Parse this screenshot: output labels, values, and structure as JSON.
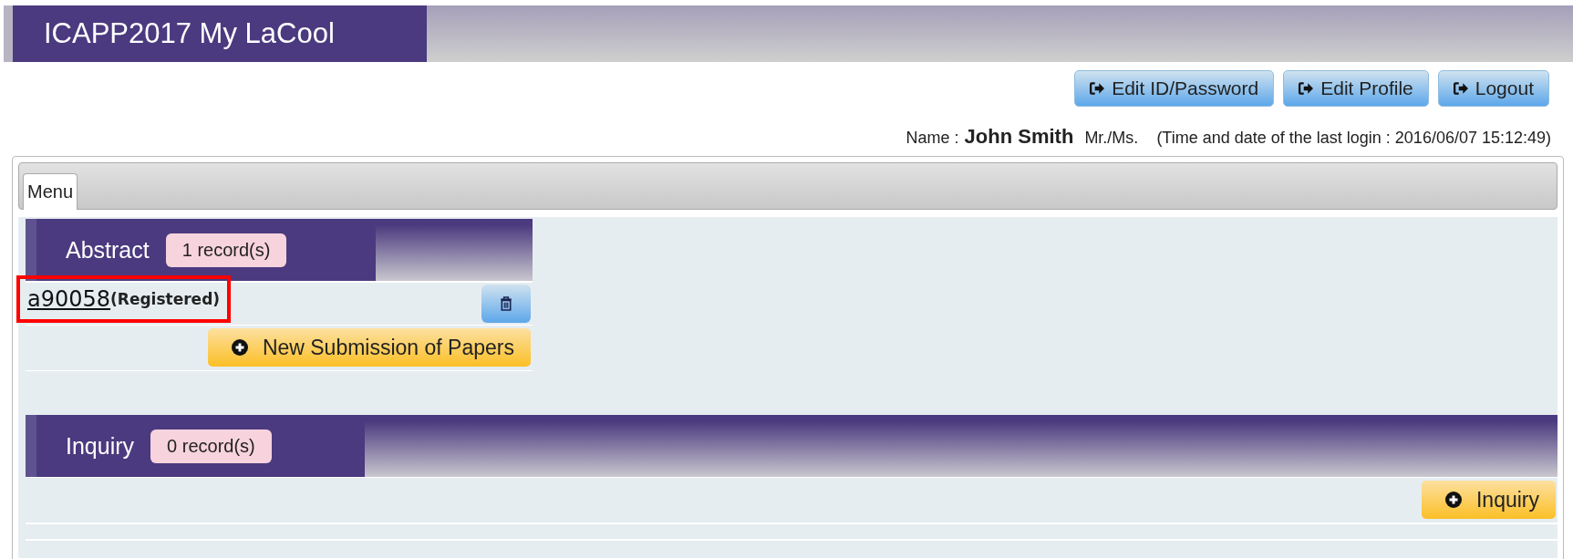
{
  "header": {
    "title": "ICAPP2017 My LaCool"
  },
  "account_buttons": [
    {
      "label": "Edit ID/Password"
    },
    {
      "label": "Edit Profile"
    },
    {
      "label": "Logout"
    }
  ],
  "user_line": {
    "name_label": "Name :",
    "name": "John Smith",
    "honorific": "Mr./Ms.",
    "last_login": "(Time and date of the last login : 2016/06/07 15:12:49)"
  },
  "tabs": [
    {
      "label": "Menu",
      "selected": true
    }
  ],
  "sections": [
    {
      "title": "Abstract",
      "count": "1 record(s)",
      "records": [
        {
          "id": "a90058",
          "status": "(Registered)",
          "highlighted": true
        }
      ],
      "action": "New Submission of Papers",
      "wide": false
    },
    {
      "title": "Inquiry",
      "count": "0 record(s)",
      "action": "Inquiry",
      "wide": true
    }
  ]
}
